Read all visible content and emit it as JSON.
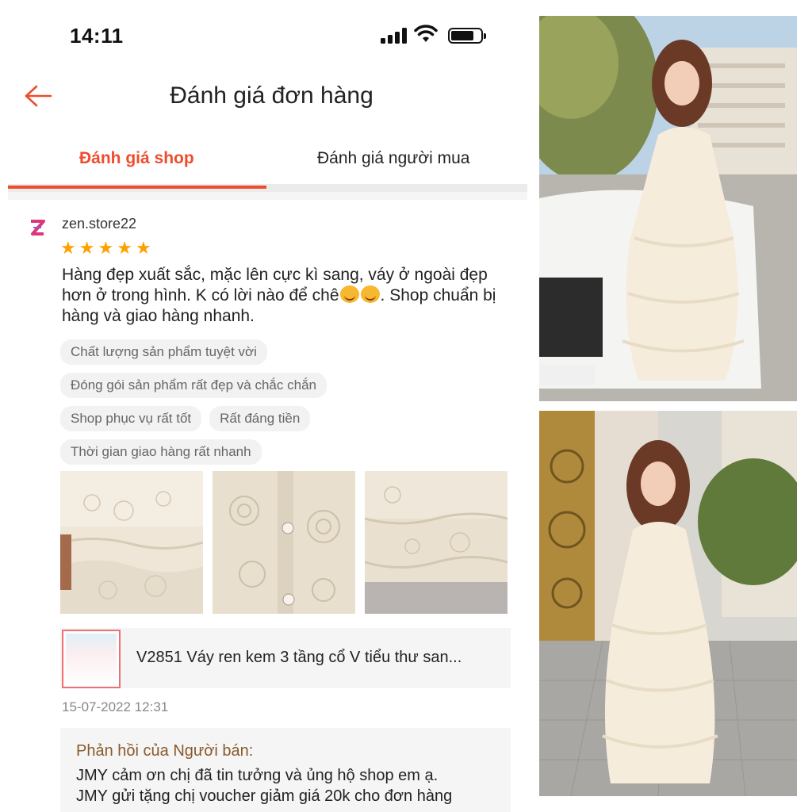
{
  "status_bar": {
    "time": "14:11"
  },
  "header": {
    "title": "Đánh giá đơn hàng"
  },
  "tabs": [
    {
      "label": "Đánh giá shop",
      "active": true
    },
    {
      "label": "Đánh giá người mua",
      "active": false
    }
  ],
  "review": {
    "username": "zen.store22",
    "rating": 5,
    "text_part1": "Hàng đẹp xuất sắc, mặc lên cực kì sang, váy ở ngoài đẹp hơn ở trong hình. K có lời nào để chê",
    "text_part2": ". Shop chuẩn bị hàng và giao hàng nhanh.",
    "tags": [
      [
        "Chất lượng sản phẩm tuyệt vời"
      ],
      [
        "Đóng gói sản phẩm rất đẹp và chắc chắn"
      ],
      [
        "Shop phục vụ rất tốt",
        "Rất đáng tiền"
      ],
      [
        "Thời gian giao hàng rất nhanh"
      ]
    ],
    "product_name": "V2851 Váy ren kem 3 tầng cổ V tiểu thư san...",
    "datetime": "15-07-2022 12:31",
    "seller_reply": {
      "title": "Phản hồi của Người bán:",
      "line1": "JMY cảm ơn chị đã tin tưởng và ủng hộ shop em ạ.",
      "line2": "JMY gửi tặng chị voucher giảm giá 20k cho đơn hàng"
    }
  },
  "colors": {
    "accent": "#ee4d2d",
    "star": "#ffa000",
    "seller_title": "#8a5a2b"
  }
}
